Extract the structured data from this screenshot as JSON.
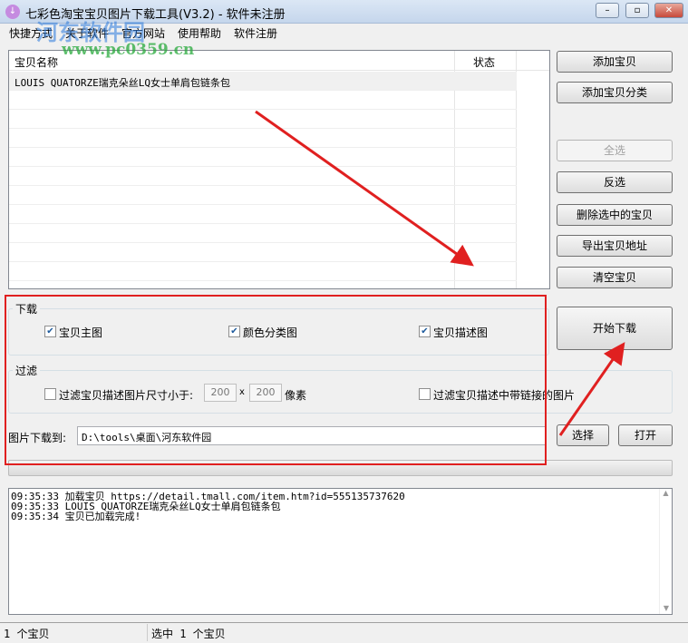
{
  "window": {
    "title": "七彩色淘宝宝贝图片下载工具(V3.2) - 软件未注册",
    "min": "–",
    "max": "▫",
    "close": "✕"
  },
  "menu": [
    "快捷方式",
    "关于软件",
    "官方网站",
    "使用帮助",
    "软件注册"
  ],
  "watermark": {
    "name": "河东软件园",
    "url": "www.pc0359.cn"
  },
  "list": {
    "col_name": "宝贝名称",
    "col_status": "状态",
    "rows": [
      {
        "name": "LOUIS QUATORZE瑞克朵丝LQ女士单肩包链条包",
        "status": ""
      }
    ]
  },
  "buttons": {
    "add_item": "添加宝贝",
    "add_category": "添加宝贝分类",
    "select_all": "全选",
    "invert": "反选",
    "delete_selected": "删除选中的宝贝",
    "export": "导出宝贝地址",
    "clear": "清空宝贝",
    "start": "开始下载",
    "choose": "选择",
    "open": "打开"
  },
  "download": {
    "label": "下载",
    "main_image": "宝贝主图",
    "color_image": "颜色分类图",
    "desc_image": "宝贝描述图"
  },
  "filter": {
    "label": "过滤",
    "size_label": "过滤宝贝描述图片尺寸小于:",
    "width": "200",
    "x": "x",
    "height": "200",
    "unit": "像素",
    "link_label": "过滤宝贝描述中带链接的图片"
  },
  "path": {
    "label": "图片下载到:",
    "value": "D:\\tools\\桌面\\河东软件园"
  },
  "progress": 0,
  "log": [
    "09:35:33 加载宝贝 https://detail.tmall.com/item.htm?id=555135737620",
    "09:35:33 LOUIS QUATORZE瑞克朵丝LQ女士单肩包链条包",
    "09:35:34 宝贝已加载完成!"
  ],
  "status": {
    "count": "1 个宝贝",
    "selected": "选中 1 个宝贝"
  },
  "colors": {
    "annotation": "#e02020"
  }
}
